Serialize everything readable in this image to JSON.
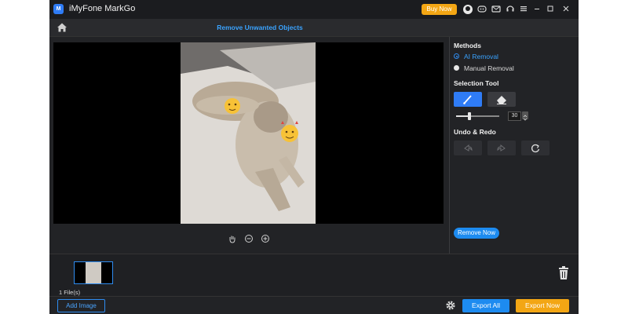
{
  "titlebar": {
    "app_title": "iMyFone MarkGo",
    "logo_text": "M",
    "buy_label": "Buy Now",
    "buy_color": "#f3a614",
    "icons": [
      "user-icon",
      "discord-icon",
      "mail-icon",
      "support-icon",
      "menu-icon",
      "minimize-icon",
      "maximize-icon",
      "close-icon"
    ]
  },
  "header": {
    "title": "Remove Unwanted Objects",
    "accent": "#3aa3ff"
  },
  "methods": {
    "title": "Methods",
    "options": [
      {
        "label": "AI Removal",
        "selected": true
      },
      {
        "label": "Manual Removal",
        "selected": false
      }
    ]
  },
  "selection_tool": {
    "title": "Selection Tool",
    "tools": [
      "brush-icon",
      "eraser-icon"
    ],
    "brush_size": "30",
    "slider_fraction": 0.3
  },
  "undo_redo": {
    "title": "Undo & Redo",
    "buttons": [
      "undo-icon",
      "redo-icon",
      "reset-icon"
    ]
  },
  "remove_label": "Remove Now",
  "canvas": {
    "zoom_icons": [
      "hand-icon",
      "zoom-out-icon",
      "zoom-in-icon"
    ]
  },
  "files": {
    "count_label": "1 File(s)"
  },
  "footer": {
    "add_label": "Add Image",
    "export_all_label": "Export All",
    "export_now_label": "Export Now",
    "primary_color": "#1d8bf0"
  }
}
